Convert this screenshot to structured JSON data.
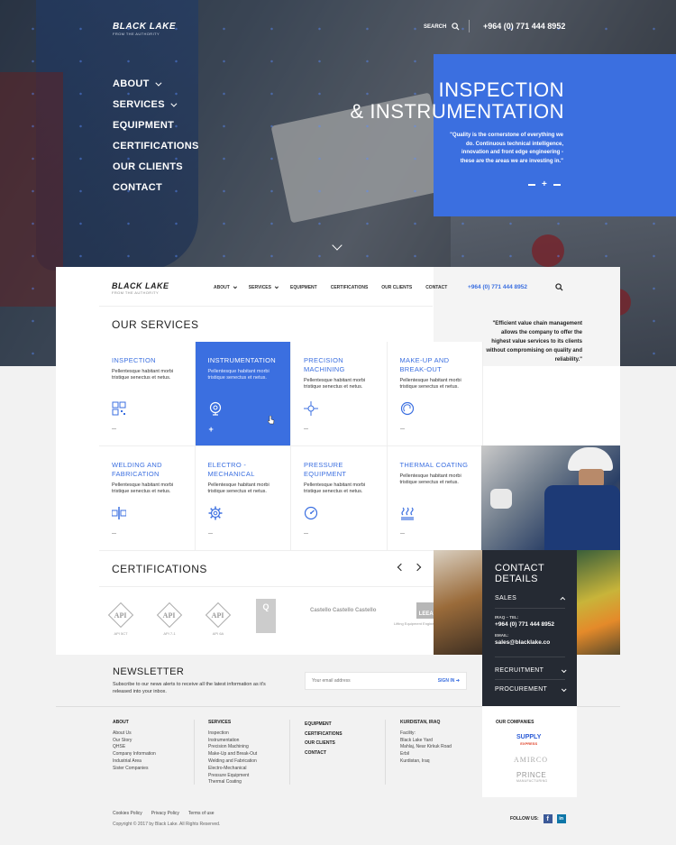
{
  "brand": {
    "word": "BLACK LAKE",
    "tagline": "FROM THE AUTHORITY"
  },
  "header": {
    "search_label": "SEARCH",
    "phone": "+964 (0) 771 444 8952"
  },
  "hero": {
    "nav": [
      "ABOUT",
      "SERVICES",
      "EQUIPMENT",
      "CERTIFICATIONS",
      "OUR CLIENTS",
      "CONTACT"
    ],
    "title_line1": "INSPECTION",
    "title_line2": "& INSTRUMENTATION",
    "quote": "\"Quality is the cornerstone of everything we do.  Continuous technical intelligence, innovation and front  edge engineering - these are the areas we are investing in.\""
  },
  "card_nav": {
    "items": [
      "ABOUT",
      "SERVICES",
      "EQUIPMENT",
      "CERTIFICATIONS",
      "OUR CLIENTS",
      "CONTACT"
    ],
    "phone": "+964 (0) 771 444 8952"
  },
  "services": {
    "title": "OUR SERVICES",
    "side_quote": "\"Efficient value chain management allows the company to offer the highest value services to its clients without compromising on quality and reliability.\"",
    "description": "Pellentesque habitant morbi tristique senectus et netus.",
    "items": [
      {
        "title": "INSPECTION",
        "icon": "qr-scan-icon"
      },
      {
        "title": "INSTRUMENTATION",
        "icon": "gauge-icon",
        "active": true
      },
      {
        "title": "PRECISION MACHINING",
        "icon": "crosshair-icon"
      },
      {
        "title": "MAKE-UP AND BREAK-OUT",
        "icon": "rotate-icon"
      },
      {
        "title": "WELDING AND FABRICATION",
        "icon": "pipe-weld-icon"
      },
      {
        "title": "ELECTRO -MECHANICAL",
        "icon": "gear-icon"
      },
      {
        "title": "PRESSURE EQUIPMENT",
        "icon": "pressure-gauge-icon"
      },
      {
        "title": "THERMAL COATING",
        "icon": "heat-icon"
      }
    ]
  },
  "certifications": {
    "title": "CERTIFICATIONS",
    "logos": [
      {
        "name": "API 5CT",
        "mark": "API"
      },
      {
        "name": "API 7-1",
        "mark": "API"
      },
      {
        "name": "API 6A",
        "mark": "API"
      },
      {
        "name": "QI",
        "mark": "Q"
      },
      {
        "name": "Castello",
        "mark": "Castello Castello Castello"
      },
      {
        "name": "LEEA",
        "mark": "LEEA",
        "sub": "Lifting Equipment Engineers Association"
      }
    ]
  },
  "contact": {
    "title": "CONTACT DETAILS",
    "sales": "SALES",
    "phone_label": "IRAQ – TEL:",
    "phone": "+964 (0) 771 444 8952",
    "email_label": "EMAIL:",
    "email": "sales@blacklake.co",
    "recruitment": "RECRUITMENT",
    "procurement": "PROCUREMENT"
  },
  "newsletter": {
    "title": "NEWSLETTER",
    "desc": "Subscribe to our news alerts to receive all the latest information as it's released into your inbox.",
    "placeholder": "Your email address",
    "button": "SIGN IN"
  },
  "footer": {
    "about": {
      "title": "ABOUT",
      "links": [
        "About Us",
        "Our Story",
        "QHSE",
        "Company Information",
        "Industrial Area",
        "Sister Companies"
      ]
    },
    "services": {
      "title": "SERVICES",
      "links": [
        "Inspection",
        "Instrumentation",
        "Precision Machining",
        "Make-Up and Break-Out",
        "Welding and Fabrication",
        "Electro-Mechanical",
        "Pressure Equipment",
        "Thermal Coating"
      ]
    },
    "misc": [
      "EQUIPMENT",
      "CERTIFICATIONS",
      "OUR CLIENTS",
      "CONTACT"
    ],
    "kurdistan": {
      "title": "KURDISTAN, IRAQ",
      "facility_label": "Facility:",
      "lines": [
        "Black Lake Yard",
        "Mahlaj, Near Kirkuk Road",
        "Erbil",
        "Kurdistan, Iraq"
      ]
    },
    "companies": {
      "title": "OUR COMPANIES",
      "supply": "SUPPLY",
      "supply_sub": "EXPRESS",
      "amirco": "AMIRCO",
      "prince": "PRINCE",
      "prince_sub": "MANUFACTURING"
    },
    "legal": [
      "Cookies Policy",
      "Privacy Policy",
      "Terms of use"
    ],
    "copyright": "Copyright © 2017 by Black Lake. All Rights Reserved.",
    "follow": "FOLLOW US:"
  },
  "colors": {
    "accent": "#3b6fe0",
    "dark": "#252a33"
  }
}
